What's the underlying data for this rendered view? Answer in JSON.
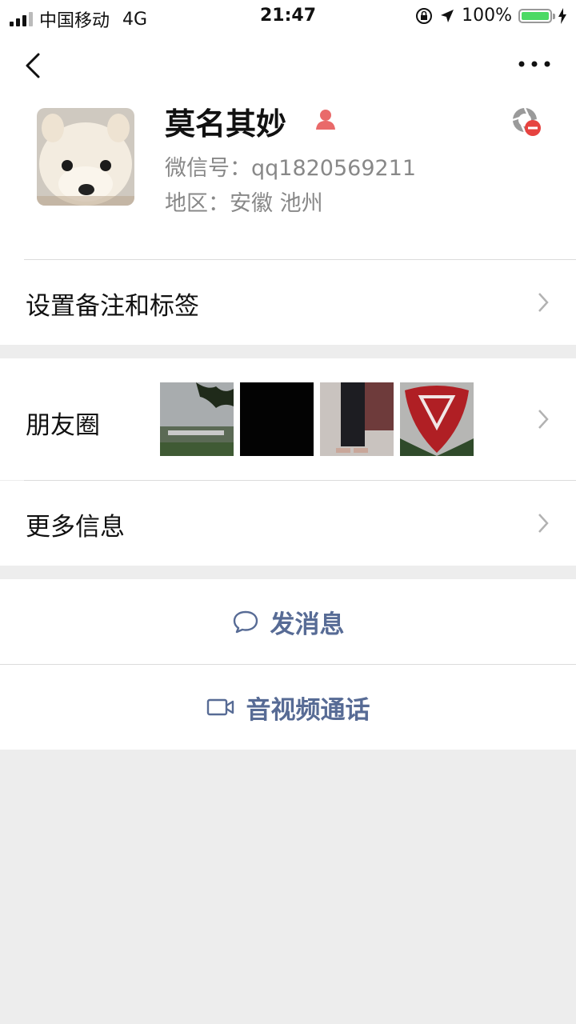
{
  "status_bar": {
    "carrier": "中国移动",
    "network": "4G",
    "time": "21:47",
    "battery": "100%"
  },
  "profile": {
    "name": "莫名其妙",
    "wechat_id_label": "微信号：",
    "wechat_id": "qq1820569211",
    "region_label": "地区：",
    "region": "安徽 池州"
  },
  "rows": {
    "remarks_label": "设置备注和标签",
    "moments_label": "朋友圈",
    "more_info_label": "更多信息"
  },
  "actions": {
    "message_label": "发消息",
    "call_label": "音视频通话"
  },
  "colors": {
    "link_blue": "#576b95",
    "gender_female": "#e96a6a",
    "battery_green": "#4cd964",
    "page_bg": "#ededed"
  }
}
